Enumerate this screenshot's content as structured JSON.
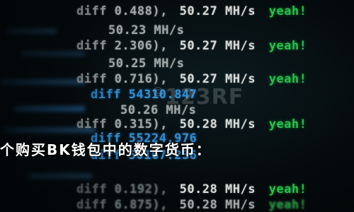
{
  "caption": "个购买BK钱包中的数字货币：",
  "watermark": {
    "symbol": "©",
    "text": "123RF"
  },
  "colors": {
    "status_green": "#22c44a",
    "highlight_blue": "#2f8fd6",
    "text": "#d7d9d6"
  },
  "lines": [
    {
      "diff": "diff 0.488),",
      "rate": "50.27 MH/s",
      "status": "yeah!"
    },
    {
      "rate": "50.23 MH/s"
    },
    {
      "diff": "diff 2.306),",
      "rate": "50.27 MH/s",
      "status": "yeah!"
    },
    {
      "rate": "50.25 MH/s"
    },
    {
      "diff": "diff 0.716),",
      "rate": "50.27 MH/s",
      "status": "yeah!"
    },
    {
      "diff": "diff 54310.847"
    },
    {
      "rate": "50.26 MH/s"
    },
    {
      "diff": "diff 0.315),",
      "rate": "50.28 MH/s",
      "status": "yeah!"
    },
    {
      "diff": "diff 55224.976"
    },
    {
      "diff": "diff 50167.236"
    },
    {
      "diff": "diff 0.192),",
      "rate": "50.28 MH/s",
      "status": "yeah!"
    },
    {
      "diff": "diff 6.875),",
      "rate": "50.28 MH/s",
      "status": "yeah!"
    }
  ]
}
